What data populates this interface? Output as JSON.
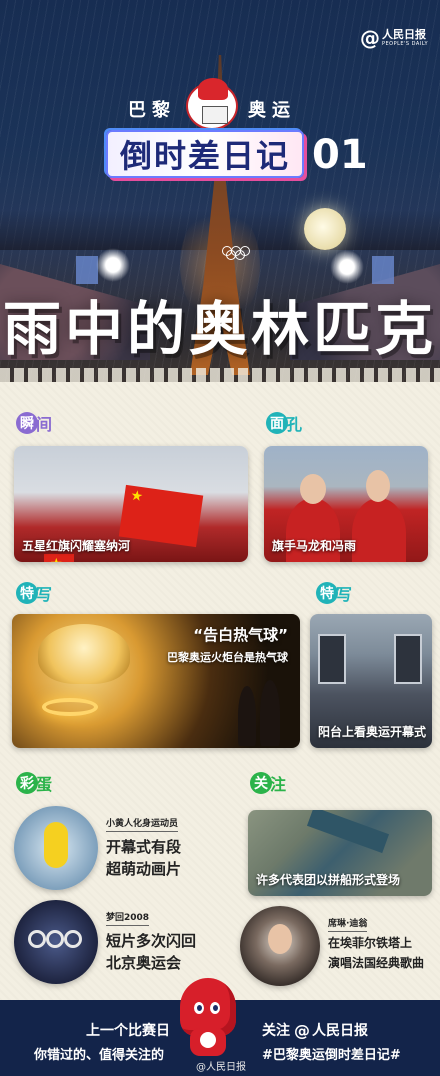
{
  "brand": {
    "cn": "人民日报",
    "en": "PEOPLE'S DAILY"
  },
  "header": {
    "left": "巴黎",
    "right": "奥运",
    "badge": "倒时差日记",
    "number": "01",
    "title": "雨中的奥林匹克"
  },
  "sections": {
    "instant": {
      "c1": "瞬",
      "c2": "间"
    },
    "face": {
      "c1": "面",
      "c2": "孔"
    },
    "close1": {
      "c1": "特",
      "c2": "写"
    },
    "close2": {
      "c1": "特",
      "c2": "写"
    },
    "egg": {
      "c1": "彩",
      "c2": "蛋"
    },
    "focus": {
      "c1": "关",
      "c2": "注"
    }
  },
  "cards": {
    "flag": "五星红旗闪耀塞纳河",
    "bearers": "旗手马龙和冯雨",
    "balloon_quote": "“告白热气球”",
    "balloon_sub": "巴黎奥运火炬台是热气球",
    "balcony": "阳台上看奥运开幕式",
    "river": "许多代表团以拼船形式登场"
  },
  "eggs": {
    "minion_tag": "小黄人化身运动员",
    "minion_line1": "开幕式有段",
    "minion_line2": "超萌动画片",
    "dream_tag": "梦回2008",
    "dream_line1": "短片多次闪回",
    "dream_line2": "北京奥运会",
    "celine_tag": "席琳·迪翁",
    "celine_line1": "在埃菲尔铁塔上",
    "celine_line2": "演唱法国经典歌曲"
  },
  "footer": {
    "left1": "上一个比赛日",
    "left2": "你错过的、值得关注的",
    "right1": "关注",
    "right_brand": "人民日报",
    "right2": "#巴黎奥运倒时差日记#",
    "credit": "@人民日报"
  },
  "colors": {
    "navy": "#13244a",
    "purple": "#8a6bd1",
    "cyan": "#20b3b8",
    "green": "#2bb34a",
    "red": "#dd2218"
  }
}
